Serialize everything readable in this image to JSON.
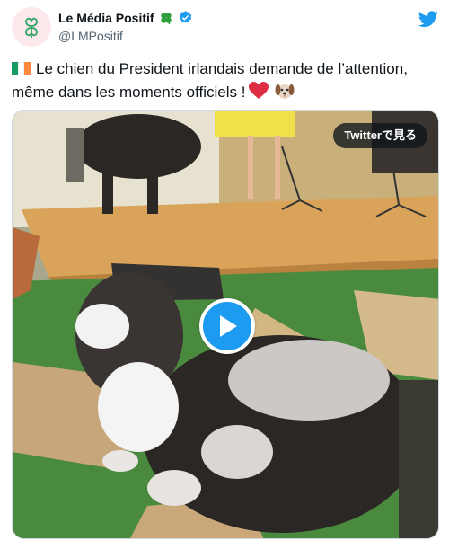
{
  "account": {
    "display_name": "Le Média Positif",
    "handle": "@LMPositif",
    "avatar_icon": "four-leaf-clover-icon",
    "name_emoji_icon": "four-leaf-clover-icon",
    "verified_icon": "verified-badge-icon"
  },
  "tweet": {
    "flag_icon": "ireland-flag-icon",
    "text": "Le chien du President irlandais demande de l’attention, même dans les moments officiels !",
    "emoji_icons": [
      "red-heart-icon",
      "dog-face-icon"
    ]
  },
  "media": {
    "view_on_twitter_label": "Twitterで見る",
    "play_icon": "play-icon"
  },
  "brand": {
    "logo_icon": "twitter-bird-icon",
    "accent": "#1d9bf0"
  }
}
